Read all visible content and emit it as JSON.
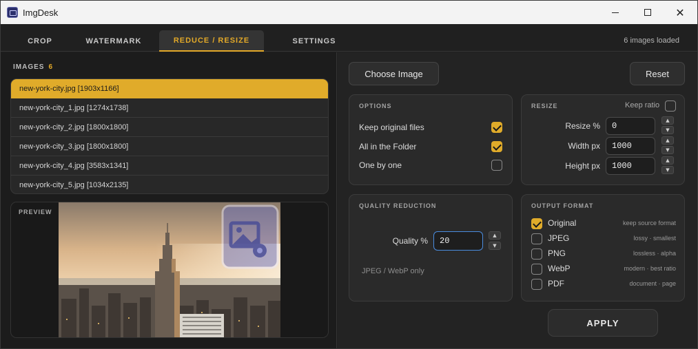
{
  "window": {
    "title": "ImgDesk",
    "min_icon": "minimize-icon",
    "max_icon": "maximize-icon",
    "close_icon": "close-icon",
    "close_glyph": "✕"
  },
  "tabs": [
    {
      "label": "CROP"
    },
    {
      "label": "WATERMARK"
    },
    {
      "label": "REDUCE / RESIZE",
      "active": true
    },
    {
      "label": "SETTINGS"
    }
  ],
  "status": {
    "loaded": "6 images loaded"
  },
  "images": {
    "heading": "IMAGES",
    "count": "6",
    "items": [
      "new-york-city.jpg [1903x1166]",
      "new-york-city_1.jpg [1274x1738]",
      "new-york-city_2.jpg [1800x1800]",
      "new-york-city_3.jpg [1800x1800]",
      "new-york-city_4.jpg [3583x1341]",
      "new-york-city_5.jpg [1034x2135]"
    ],
    "selected_index": 0
  },
  "preview": {
    "label": "PREVIEW"
  },
  "actions": {
    "choose_image": "Choose Image",
    "reset": "Reset",
    "apply": "APPLY"
  },
  "options": {
    "title": "OPTIONS",
    "items": [
      {
        "label": "Keep original files",
        "checked": true
      },
      {
        "label": "All in the Folder",
        "checked": true
      },
      {
        "label": "One by one",
        "checked": false
      }
    ]
  },
  "resize": {
    "title": "RESIZE",
    "keep_ratio_label": "Keep ratio",
    "keep_ratio": false,
    "resize_pct_label": "Resize %",
    "resize_pct_value": "0",
    "width_label": "Width px",
    "width_value": "1000",
    "height_label": "Height px",
    "height_value": "1000",
    "spin_up": "▲",
    "spin_down": "▼"
  },
  "quality": {
    "title": "QUALITY REDUCTION",
    "label": "Quality %",
    "value": "20",
    "hint": "JPEG / WebP only"
  },
  "output": {
    "title": "OUTPUT FORMAT",
    "formats": [
      {
        "name": "Original",
        "desc": "keep source format",
        "checked": true
      },
      {
        "name": "JPEG",
        "desc": "lossy · smallest",
        "checked": false
      },
      {
        "name": "PNG",
        "desc": "lossless · alpha",
        "checked": false
      },
      {
        "name": "WebP",
        "desc": "modern · best ratio",
        "checked": false
      },
      {
        "name": "PDF",
        "desc": "document · page",
        "checked": false
      }
    ]
  },
  "colors": {
    "accent": "#e0ab2a",
    "focus": "#4a8de0"
  }
}
